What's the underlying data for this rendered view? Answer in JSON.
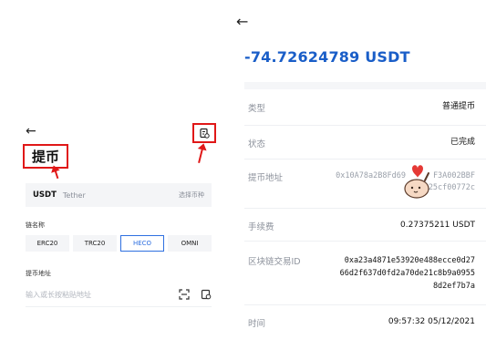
{
  "left": {
    "back_icon": "arrow-left",
    "history_icon": "history-record",
    "title": "提币",
    "coin": {
      "symbol": "USDT",
      "name": "Tether",
      "choose_label": "选择币种"
    },
    "chain_label": "链名称",
    "chains": [
      {
        "label": "ERC20",
        "active": false
      },
      {
        "label": "TRC20",
        "active": false
      },
      {
        "label": "HECO",
        "active": true
      },
      {
        "label": "OMNI",
        "active": false
      }
    ],
    "address_label": "提币地址",
    "address_placeholder": "输入或长按粘贴地址",
    "scan_icon": "scan",
    "address_book_icon": "address-book"
  },
  "right": {
    "back_icon": "arrow-left",
    "amount": "-74.72624789 USDT",
    "rows": {
      "type": {
        "label": "类型",
        "value": "普通提币"
      },
      "status": {
        "label": "状态",
        "value": "已完成"
      },
      "address": {
        "label": "提币地址",
        "line1": "0x10A78a2B8Fd69",
        "line1_tail": "F3A002BBF",
        "line2": "25cf00772c"
      },
      "fee": {
        "label": "手续费",
        "value": "0.27375211 USDT"
      },
      "txid": {
        "label": "区块链交易ID",
        "line1": "0xa23a4871e53920e488ecce0d27",
        "line2": "66d2f637d0fd2a70de21c8b9a0955",
        "line3": "8d2ef7b7a"
      },
      "time": {
        "label": "时间",
        "value": "09:57:32 05/12/2021"
      }
    }
  },
  "colors": {
    "accent_blue": "#1a5ec8",
    "highlight_red": "#e01818"
  }
}
